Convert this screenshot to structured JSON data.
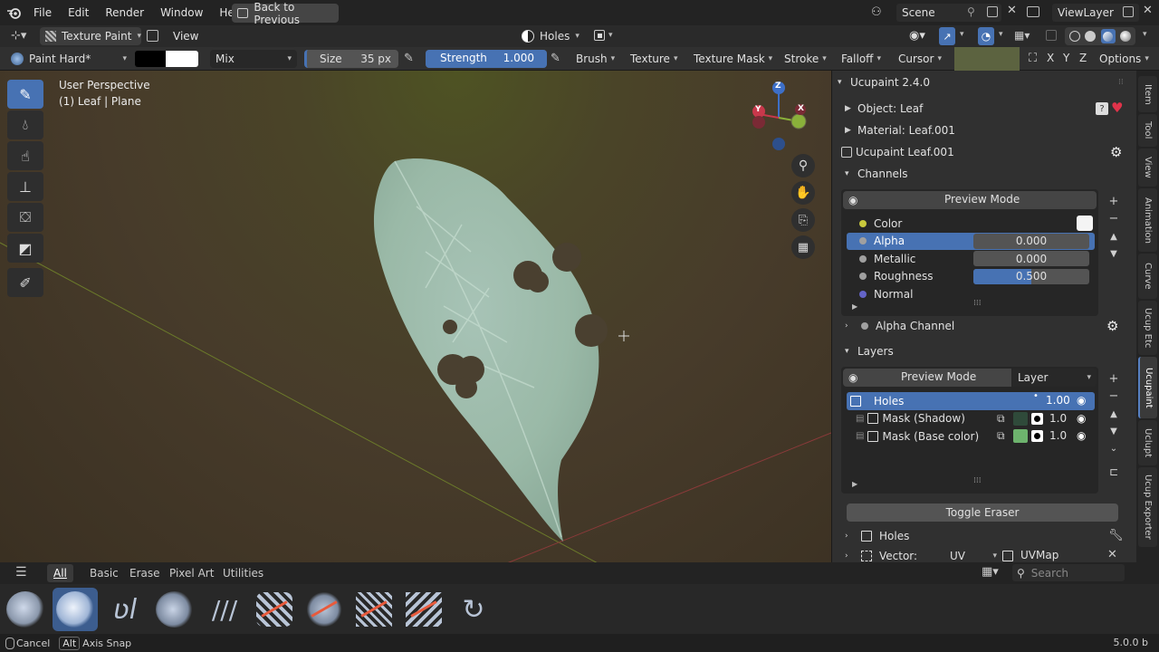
{
  "menubar": {
    "items": [
      "File",
      "Edit",
      "Render",
      "Window",
      "Help"
    ],
    "back_button": "Back to Previous",
    "scene": "Scene",
    "view_layer": "ViewLayer"
  },
  "header": {
    "mode": "Texture Paint",
    "view": "View",
    "slot": "Holes"
  },
  "toolsettings": {
    "brush_name": "Paint Hard*",
    "blend": "Mix",
    "size_label": "Size",
    "size_value": "35 px",
    "strength_label": "Strength",
    "strength_value": "1.000",
    "strength_fill": 1.0,
    "menus": [
      "Brush",
      "Texture",
      "Texture Mask",
      "Stroke",
      "Falloff",
      "Cursor"
    ],
    "axes": [
      "X",
      "Y",
      "Z"
    ],
    "options": "Options"
  },
  "viewport": {
    "perspective": "User Perspective",
    "object_info": "(1) Leaf | Plane",
    "gizmo_z": "Z",
    "gizmo_y": "Y",
    "gizmo_x": "X"
  },
  "npanel": {
    "addon_title": "Ucupaint 2.4.0",
    "object": "Object: Leaf",
    "material": "Material: Leaf.001",
    "tree": "Ucupaint Leaf.001",
    "channels_header": "Channels",
    "preview_mode": "Preview Mode",
    "channels": [
      {
        "name": "Color",
        "value": "",
        "color": "#c8c83c"
      },
      {
        "name": "Alpha",
        "value": "0.000",
        "color": "#a0a0a0"
      },
      {
        "name": "Metallic",
        "value": "0.000",
        "color": "#a0a0a0"
      },
      {
        "name": "Roughness",
        "value": "0.500",
        "color": "#a0a0a0"
      },
      {
        "name": "Normal",
        "value": "",
        "color": "#6464c8"
      }
    ],
    "roughness_fill": 0.5,
    "alpha_channel": "Alpha Channel",
    "layers_header": "Layers",
    "layers_preview": "Preview Mode",
    "layers_dropdown": "Layer",
    "layers": [
      {
        "name": "Holes",
        "value": "1.00"
      },
      {
        "name": "Mask (Shadow)",
        "value": "1.0"
      },
      {
        "name": "Mask (Base color)",
        "value": "1.0"
      }
    ],
    "toggle_eraser": "Toggle Eraser",
    "holes_row": "Holes",
    "vector_label": "Vector:",
    "vector_value": "UV",
    "uvmap": "UVMap"
  },
  "side_tabs": [
    "Item",
    "Tool",
    "View",
    "Animation",
    "Curve",
    "Ucup Etc",
    "Ucupaint",
    "Uclupt",
    "Ucup Exporter"
  ],
  "asset_shelf": {
    "tabs": [
      "All",
      "Basic",
      "Erase",
      "Pixel Art",
      "Utilities"
    ],
    "search_placeholder": "Search"
  },
  "status": {
    "cancel": "Cancel",
    "alt_key": "Alt",
    "axis_snap": "Axis Snap",
    "version": "5.0.0 b"
  },
  "colors": {
    "accent": "#4772b3",
    "panel": "#303030",
    "base_color_swatch": "#6db36d",
    "shadow_swatch": "#2f4a3a"
  }
}
